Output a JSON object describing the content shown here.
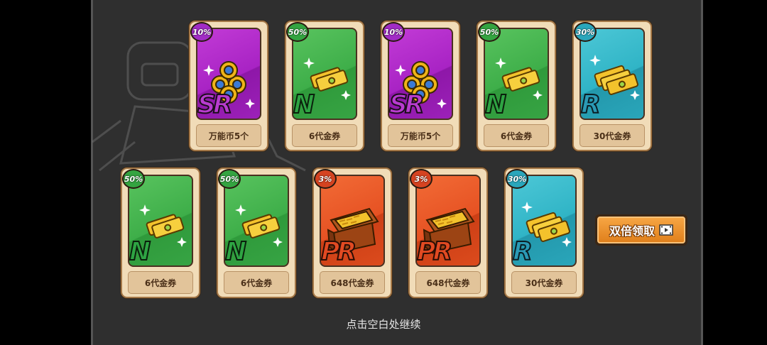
{
  "cards": [
    {
      "rarity": "SR",
      "percent": "10%",
      "name": "万能币5个",
      "item": "coins"
    },
    {
      "rarity": "N",
      "percent": "50%",
      "name": "6代金券",
      "item": "ticket"
    },
    {
      "rarity": "SR",
      "percent": "10%",
      "name": "万能币5个",
      "item": "coins"
    },
    {
      "rarity": "N",
      "percent": "50%",
      "name": "6代金券",
      "item": "ticket"
    },
    {
      "rarity": "R",
      "percent": "30%",
      "name": "30代金券",
      "item": "tickets"
    },
    {
      "rarity": "N",
      "percent": "50%",
      "name": "6代金券",
      "item": "ticket"
    },
    {
      "rarity": "N",
      "percent": "50%",
      "name": "6代金券",
      "item": "ticket"
    },
    {
      "rarity": "PR",
      "percent": "3%",
      "name": "648代金券",
      "item": "chest"
    },
    {
      "rarity": "PR",
      "percent": "3%",
      "name": "648代金券",
      "item": "chest"
    },
    {
      "rarity": "R",
      "percent": "30%",
      "name": "30代金券",
      "item": "tickets"
    }
  ],
  "double_button": {
    "label": "双倍领取",
    "icon": "video-icon"
  },
  "continue_hint": "点击空白处继续"
}
